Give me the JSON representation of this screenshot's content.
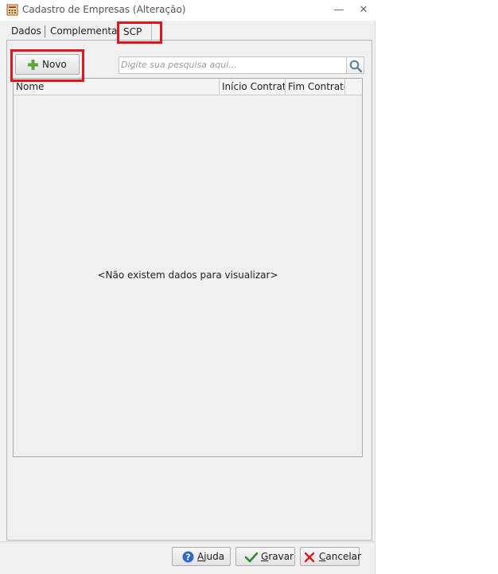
{
  "window": {
    "title": "Cadastro de Empresas (Alteração)",
    "minimize_glyph": "—",
    "close_glyph": "✕"
  },
  "tabs": [
    {
      "label": "Dados"
    },
    {
      "label": "Complementar"
    },
    {
      "label": "SCP",
      "active": true
    }
  ],
  "toolbar": {
    "new_label": "Novo",
    "new_icon": "plus-icon",
    "search_placeholder": "Digite sua pesquisa aqui..."
  },
  "grid": {
    "columns": [
      "Nome",
      "Início Contrato",
      "Fim Contrato"
    ],
    "empty_message": "<Não existem dados para visualizar>"
  },
  "footer": {
    "help_prefix": "A",
    "help_rest": "juda",
    "save_prefix": "G",
    "save_rest": "ravar",
    "cancel_prefix": "C",
    "cancel_rest": "ancelar"
  },
  "colors": {
    "highlight": "#e3141b",
    "plus_green": "#5aa63a",
    "check_green": "#2f8a2f",
    "cancel_red": "#d62020",
    "help_blue": "#2d6bc4"
  }
}
